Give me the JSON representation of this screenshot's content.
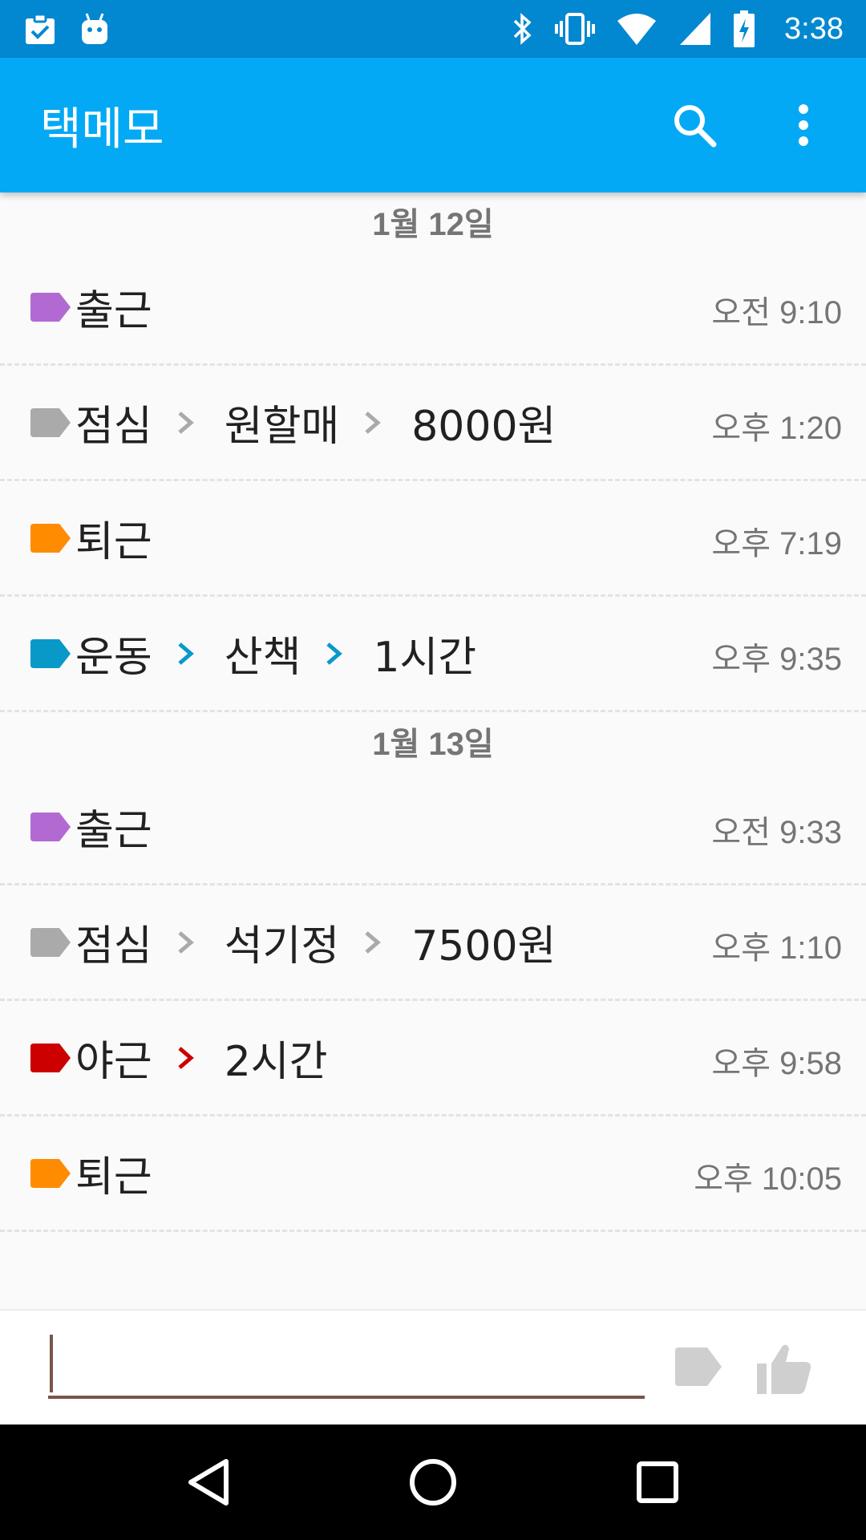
{
  "status_bar": {
    "time": "3:38",
    "icons_left": [
      "clipboard-check-icon",
      "android-icon"
    ],
    "icons_right": [
      "bluetooth-icon",
      "vibrate-icon",
      "wifi-icon",
      "signal-icon",
      "battery-charging-icon"
    ]
  },
  "app_bar": {
    "title": "택메모",
    "actions": [
      "search-icon",
      "more-vert-icon"
    ]
  },
  "colors": {
    "status_bar": "#0288d1",
    "app_bar": "#03a9f4",
    "purple": "#b26ad2",
    "gray": "#aaaaaa",
    "orange": "#ff8c00",
    "blue": "#0899c9",
    "red": "#cc0000",
    "input_underline": "#795548"
  },
  "groups": [
    {
      "date": "1월 12일",
      "entries": [
        {
          "color": "#b26ad2",
          "chevron_color": "#aaaaaa",
          "parts": [
            "출근"
          ],
          "time": "오전 9:10"
        },
        {
          "color": "#aaaaaa",
          "chevron_color": "#aaaaaa",
          "parts": [
            "점심",
            "원할매",
            "8000원"
          ],
          "time": "오후 1:20"
        },
        {
          "color": "#ff8c00",
          "chevron_color": "#aaaaaa",
          "parts": [
            "퇴근"
          ],
          "time": "오후 7:19"
        },
        {
          "color": "#0899c9",
          "chevron_color": "#0899c9",
          "parts": [
            "운동",
            "산책",
            "1시간"
          ],
          "time": "오후 9:35"
        }
      ]
    },
    {
      "date": "1월 13일",
      "entries": [
        {
          "color": "#b26ad2",
          "chevron_color": "#aaaaaa",
          "parts": [
            "출근"
          ],
          "time": "오전 9:33"
        },
        {
          "color": "#aaaaaa",
          "chevron_color": "#aaaaaa",
          "parts": [
            "점심",
            "석기정",
            "7500원"
          ],
          "time": "오후 1:10"
        },
        {
          "color": "#cc0000",
          "chevron_color": "#cc0000",
          "parts": [
            "야근",
            "2시간"
          ],
          "time": "오후 9:58"
        },
        {
          "color": "#ff8c00",
          "chevron_color": "#aaaaaa",
          "parts": [
            "퇴근"
          ],
          "time": "오후 10:05"
        }
      ]
    }
  ],
  "input_bar": {
    "value": "",
    "placeholder": "",
    "buttons": [
      "tag-icon",
      "thumbs-up-icon"
    ]
  },
  "nav_bar": {
    "buttons": [
      "back-icon",
      "home-icon",
      "recents-icon"
    ]
  }
}
